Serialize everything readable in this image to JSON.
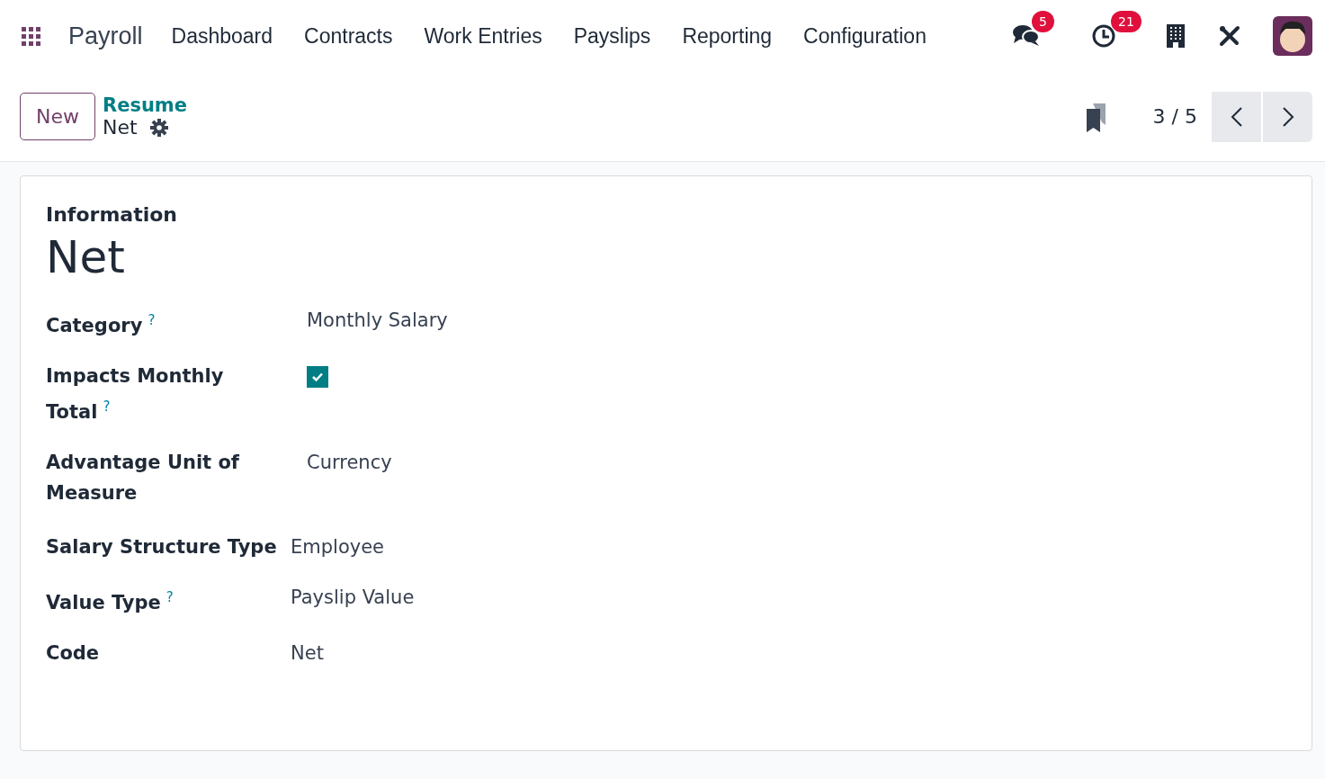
{
  "navbar": {
    "app_name": "Payroll",
    "menu": [
      "Dashboard",
      "Contracts",
      "Work Entries",
      "Payslips",
      "Reporting",
      "Configuration"
    ],
    "messages_badge": "5",
    "activities_badge": "21"
  },
  "control_panel": {
    "new_button": "New",
    "breadcrumb": "Resume",
    "record_name": "Net",
    "pager": "3 / 5"
  },
  "form": {
    "section_title": "Information",
    "name": "Net",
    "groups": [
      {
        "fields": [
          {
            "kind": "text",
            "label": "Category",
            "help": "?",
            "value": "Monthly Salary"
          },
          {
            "kind": "checkbox",
            "label": "Impacts Monthly Total",
            "help": "?",
            "checked": true
          },
          {
            "kind": "text",
            "label": "Advantage Unit of Measure",
            "value": "Currency"
          }
        ]
      },
      {
        "fields": [
          {
            "kind": "text",
            "label": "Salary Structure Type",
            "value": "Employee"
          },
          {
            "kind": "text",
            "label": "Value Type",
            "help": "?",
            "value": "Payslip Value"
          },
          {
            "kind": "text",
            "label": "Code",
            "value": "Net"
          }
        ]
      }
    ]
  }
}
